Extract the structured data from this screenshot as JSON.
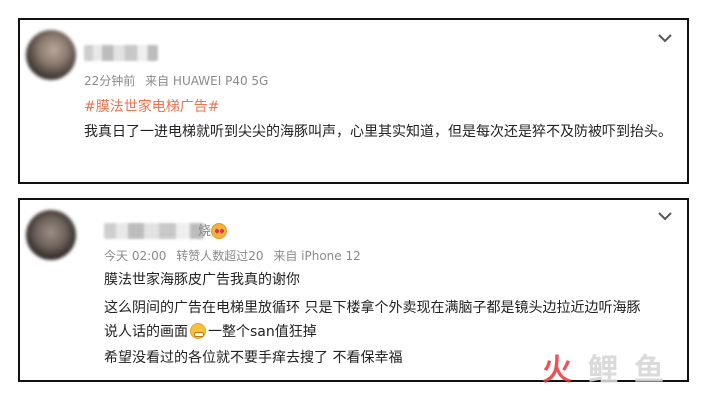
{
  "posts": [
    {
      "meta": {
        "time": "22分钟前",
        "source": "来自 HUAWEI P40 5G"
      },
      "hashtag": "#膜法世家电梯广告#",
      "text": "我真日了一进电梯就听到尖尖的海豚叫声，心里其实知道，但是每次还是猝不及防被吓到抬头。"
    },
    {
      "meta": {
        "time": "今天 02:00",
        "reposts": "转赞人数超过20",
        "source": "来自 iPhone 12"
      },
      "username_tail": "烧",
      "lines": [
        "膜法世家海豚皮广告我真的谢你",
        "这么阴间的广告在电梯里放循环 只是下楼拿个外卖现在满脑子都是镜头边拉近边听海豚",
        "说人话的画面",
        "一整个san值狂掉",
        "希望没看过的各位就不要手痒去搜了 不看保幸福"
      ]
    }
  ],
  "watermark": {
    "label": "鲤鱼",
    "accent": "#e5383b",
    "muted": "#cfcfcf"
  },
  "colors": {
    "hashtag": "#eb7350",
    "meta": "#8a8a8a",
    "border": "#111111"
  }
}
